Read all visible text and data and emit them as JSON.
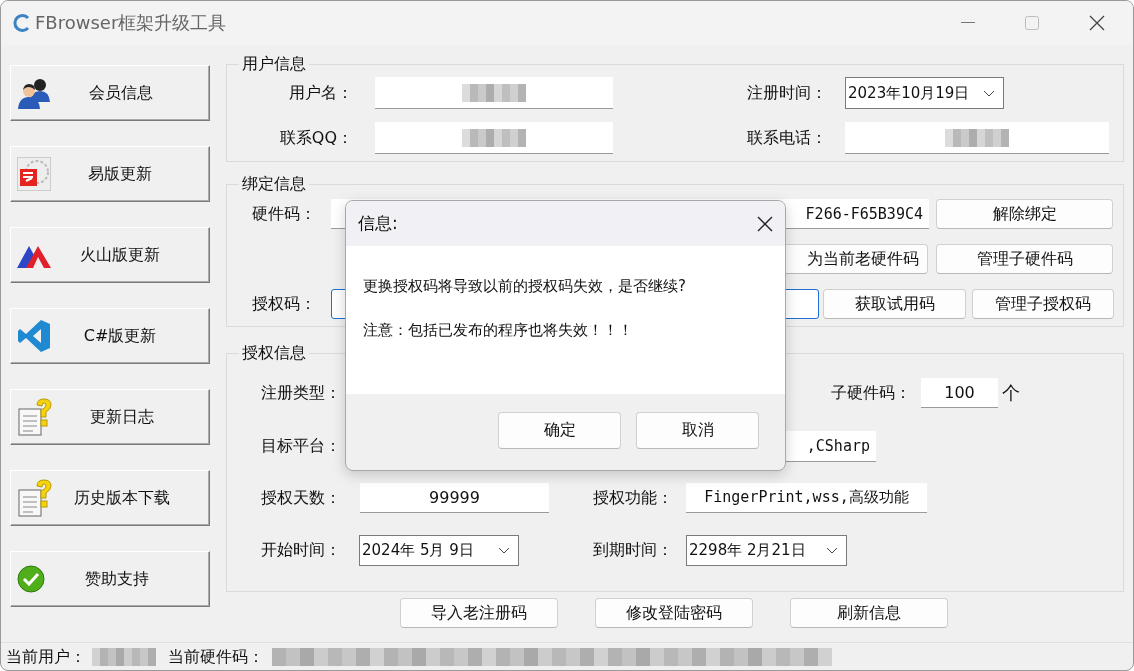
{
  "window": {
    "title": "FBrowser框架升级工具"
  },
  "sidebar": {
    "items": [
      {
        "label": "会员信息"
      },
      {
        "label": "易版更新"
      },
      {
        "label": "火山版更新"
      },
      {
        "label": "C#版更新"
      },
      {
        "label": "更新日志"
      },
      {
        "label": "历史版本下载"
      },
      {
        "label": "赞助支持"
      }
    ]
  },
  "user_info": {
    "title": "用户信息",
    "fields": [
      {
        "label": "用户名：",
        "kind": "redacted"
      },
      {
        "label": "注册时间：",
        "kind": "date",
        "value": "2023年10月19日"
      },
      {
        "label": "联系QQ：",
        "kind": "redacted"
      },
      {
        "label": "联系电话：",
        "kind": "redacted"
      }
    ]
  },
  "binding": {
    "title": "绑定信息",
    "hardware_code": {
      "label": "硬件码：",
      "value": "F266-F65B39C4"
    },
    "license_code": {
      "label": "授权码：",
      "focused": true
    },
    "buttons": [
      "解除绑定",
      "为当前老硬件码",
      "管理子硬件码",
      "获取试用码",
      "管理子授权码"
    ]
  },
  "license_info": {
    "title": "授权信息",
    "register_type": {
      "label": "注册类型："
    },
    "sub_hardware": {
      "label": "子硬件码：",
      "value": "100",
      "unit": "个"
    },
    "platform": {
      "label": "目标平台：",
      "value": ",CSharp"
    },
    "days": {
      "label": "授权天数：",
      "value": "99999"
    },
    "features": {
      "label": "授权功能：",
      "value": "FingerPrint,wss,高级功能"
    },
    "start": {
      "label": "开始时间：",
      "value": "2024年 5月 9日"
    },
    "end": {
      "label": "到期时间：",
      "value": "2298年 2月21日"
    }
  },
  "actions": [
    "导入老注册码",
    "修改登陆密码",
    "刷新信息"
  ],
  "status_bar": {
    "user_label": "当前用户：",
    "hardware_label": "当前硬件码："
  },
  "dialog": {
    "title": "信息:",
    "lines": [
      "更换授权码将导致以前的授权码失效，是否继续?",
      "注意：包括已发布的程序也将失效！！！"
    ],
    "buttons": [
      "确定",
      "取消"
    ]
  }
}
